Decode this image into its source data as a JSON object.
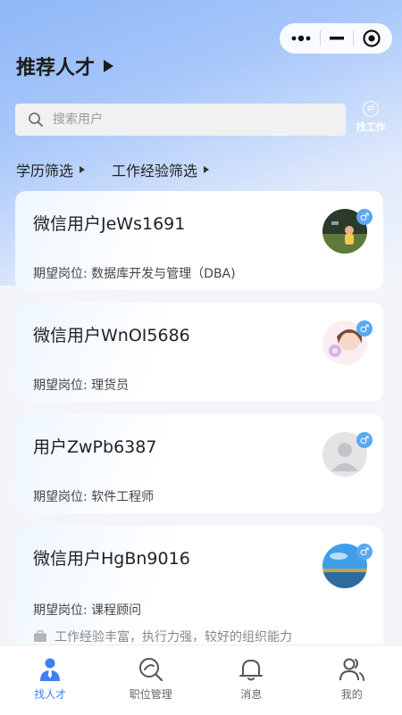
{
  "header": {
    "title": "推荐人才"
  },
  "search": {
    "placeholder": "搜索用户"
  },
  "find_job": {
    "label": "找工作"
  },
  "filters": [
    {
      "label": "学历筛选"
    },
    {
      "label": "工作经验筛选"
    }
  ],
  "candidates": [
    {
      "name": "微信用户JeWs1691",
      "position": "期望岗位: 数据库开发与管理（DBA)",
      "gender": "male"
    },
    {
      "name": "微信用户WnOI5686",
      "position": "期望岗位: 理货员",
      "gender": "male"
    },
    {
      "name": "用户ZwPb6387",
      "position": "期望岗位: 软件工程师",
      "gender": "male"
    },
    {
      "name": "微信用户HgBn9016",
      "position": "期望岗位: 课程顾问",
      "advantage": "工作经验丰富，执行力强，较好的组织能力",
      "gender": "male"
    }
  ],
  "tabbar": [
    {
      "label": "找人才",
      "icon": "person-tie-icon",
      "active": true
    },
    {
      "label": "职位管理",
      "icon": "position-search-icon",
      "active": false
    },
    {
      "label": "消息",
      "icon": "bell-icon",
      "active": false
    },
    {
      "label": "我的",
      "icon": "profile-icon",
      "active": false
    }
  ],
  "colors": {
    "accent": "#3b82f0",
    "gender_badge": "#5aa9ef"
  }
}
